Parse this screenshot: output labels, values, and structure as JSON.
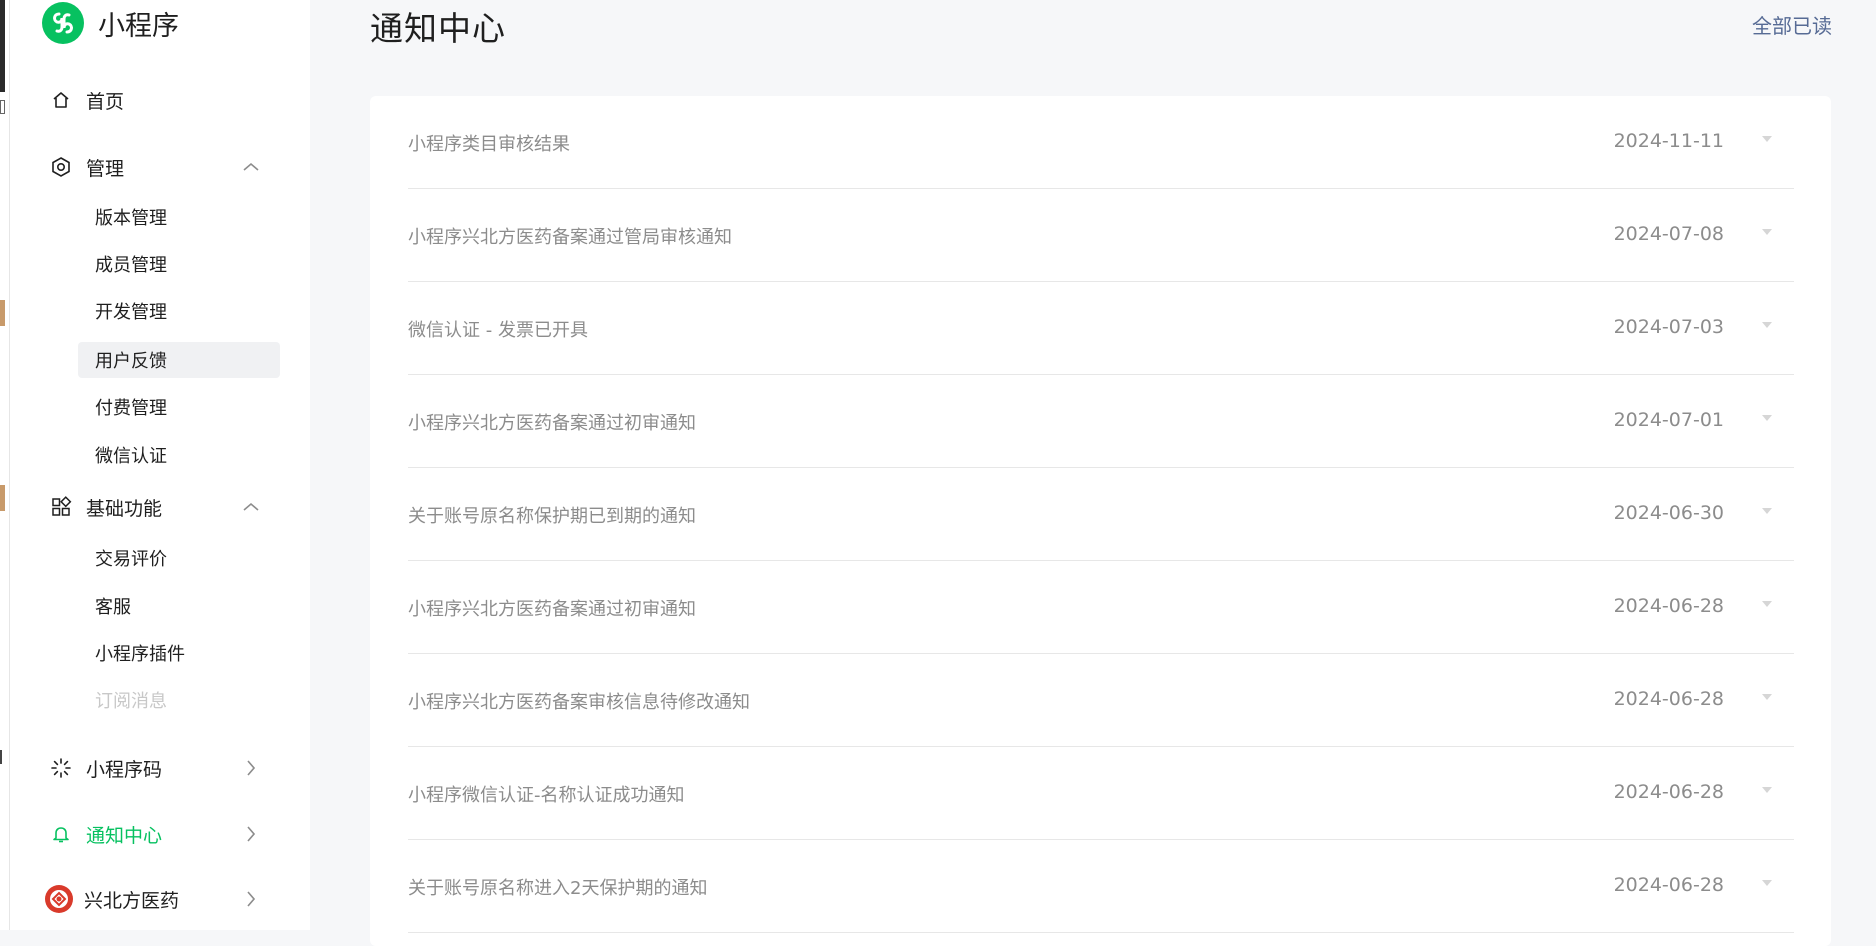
{
  "app": {
    "name": "小程序",
    "brand_color": "#07c160"
  },
  "nav": {
    "home": {
      "label": "首页",
      "icon": "home-icon"
    },
    "manage": {
      "label": "管理",
      "icon": "settings-hexagon-icon",
      "items": [
        "版本管理",
        "成员管理",
        "开发管理",
        "用户反馈",
        "付费管理",
        "微信认证"
      ],
      "selected": "用户反馈"
    },
    "basic": {
      "label": "基础功能",
      "icon": "grid-icon",
      "items": [
        "交易评价",
        "客服",
        "小程序插件",
        "订阅消息"
      ]
    },
    "qrcode": {
      "label": "小程序码",
      "icon": "sun-burst-icon"
    },
    "notify": {
      "label": "通知中心",
      "icon": "bell-icon",
      "active": true
    },
    "account": {
      "label": "兴北方医药",
      "icon": "account-avatar-icon"
    }
  },
  "page": {
    "title": "通知中心",
    "mark_all_read": "全部已读"
  },
  "notifications": [
    {
      "title": "小程序类目审核结果",
      "date": "2024-11-11"
    },
    {
      "title": "小程序兴北方医药备案通过管局审核通知",
      "date": "2024-07-08"
    },
    {
      "title": "微信认证 - 发票已开具",
      "date": "2024-07-03"
    },
    {
      "title": "小程序兴北方医药备案通过初审通知",
      "date": "2024-07-01"
    },
    {
      "title": "关于账号原名称保护期已到期的通知",
      "date": "2024-06-30"
    },
    {
      "title": "小程序兴北方医药备案通过初审通知",
      "date": "2024-06-28"
    },
    {
      "title": "小程序兴北方医药备案审核信息待修改通知",
      "date": "2024-06-28"
    },
    {
      "title": "小程序微信认证-名称认证成功通知",
      "date": "2024-06-28"
    },
    {
      "title": "关于账号原名称进入2天保护期的通知",
      "date": "2024-06-28"
    }
  ]
}
